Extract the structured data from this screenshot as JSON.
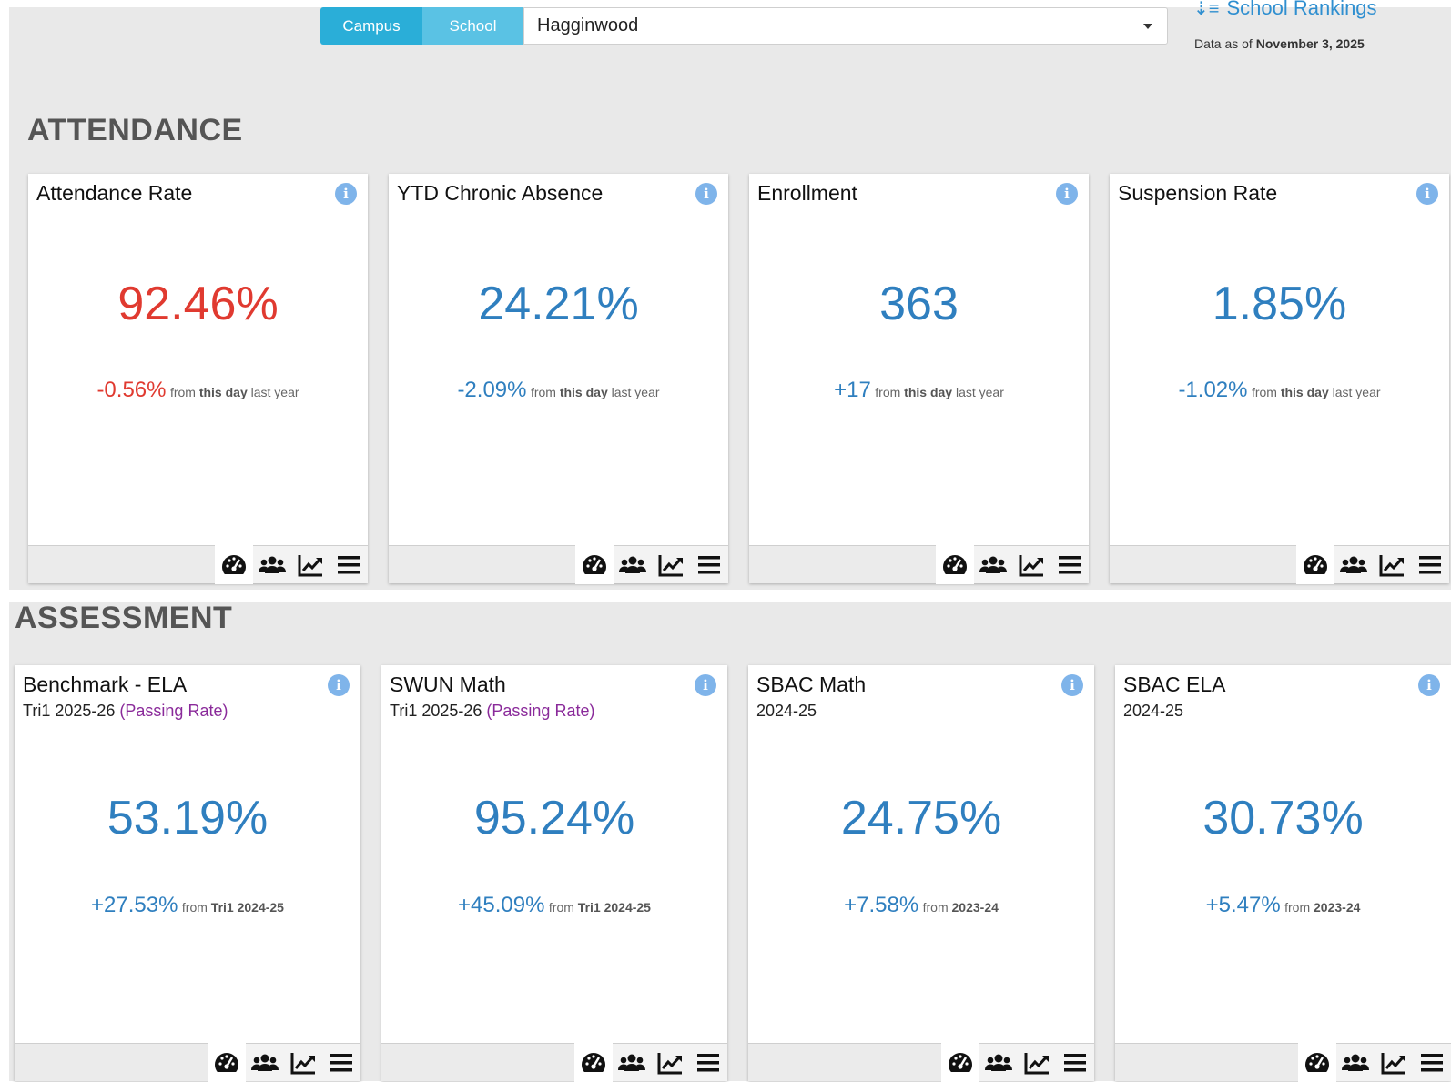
{
  "header": {
    "campus_label": "Campus",
    "school_label": "School",
    "selected_school": "Hagginwood",
    "rankings_label": "School Rankings",
    "data_asof_prefix": "Data as of",
    "data_asof_date": "November 3, 2025"
  },
  "attendance": {
    "title": "ATTENDANCE",
    "cards": [
      {
        "title": "Attendance Rate",
        "value": "92.46%",
        "delta": "-0.56%",
        "from": "from",
        "from_bold": "this day",
        "from_tail": "last year",
        "color": "#e03a30"
      },
      {
        "title": "YTD Chronic Absence",
        "value": "24.21%",
        "delta": "-2.09%",
        "from": "from",
        "from_bold": "this day",
        "from_tail": "last year",
        "color": "#2f7fbf"
      },
      {
        "title": "Enrollment",
        "value": "363",
        "delta": "+17",
        "from": "from",
        "from_bold": "this day",
        "from_tail": "last year",
        "color": "#2f7fbf"
      },
      {
        "title": "Suspension Rate",
        "value": "1.85%",
        "delta": "-1.02%",
        "from": "from",
        "from_bold": "this day",
        "from_tail": "last year",
        "color": "#2f7fbf"
      }
    ]
  },
  "assessment": {
    "title": "ASSESSMENT",
    "cards": [
      {
        "title": "Benchmark - ELA",
        "sub": "Tri1 2025-26",
        "sub_extra": "(Passing Rate)",
        "value": "53.19%",
        "delta": "+27.53%",
        "from": "from",
        "from_bold": "Tri1 2024-25",
        "color": "#2f7fbf"
      },
      {
        "title": "SWUN Math",
        "sub": "Tri1 2025-26",
        "sub_extra": "(Passing Rate)",
        "value": "95.24%",
        "delta": "+45.09%",
        "from": "from",
        "from_bold": "Tri1 2024-25",
        "color": "#2f7fbf"
      },
      {
        "title": "SBAC Math",
        "sub": "2024-25",
        "sub_extra": "",
        "value": "24.75%",
        "delta": "+7.58%",
        "from": "from",
        "from_bold": "2023-24",
        "color": "#2f7fbf"
      },
      {
        "title": "SBAC ELA",
        "sub": "2024-25",
        "sub_extra": "",
        "value": "30.73%",
        "delta": "+5.47%",
        "from": "from",
        "from_bold": "2023-24",
        "color": "#2f7fbf"
      }
    ]
  },
  "icons": {
    "info": "info-icon",
    "dashboard": "gauge-icon",
    "students": "users-group-icon",
    "trend": "trend-chart-icon",
    "list": "list-icon"
  }
}
